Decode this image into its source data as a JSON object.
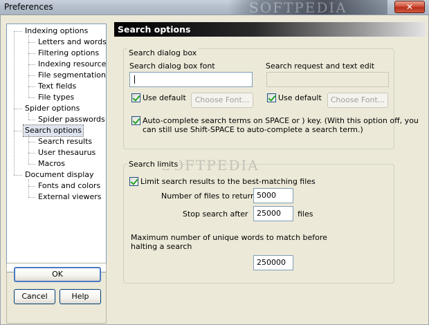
{
  "window": {
    "title": "Preferences",
    "close_glyph": "✕",
    "watermark": "SOFTPEDIA"
  },
  "tree": {
    "items": [
      {
        "label": "Indexing options",
        "level": 0
      },
      {
        "label": "Letters and words",
        "level": 1
      },
      {
        "label": "Filtering options",
        "level": 1
      },
      {
        "label": "Indexing resources",
        "level": 1
      },
      {
        "label": "File segmentation",
        "level": 1
      },
      {
        "label": "Text fields",
        "level": 1
      },
      {
        "label": "File types",
        "level": 1
      },
      {
        "label": "Spider options",
        "level": 0
      },
      {
        "label": "Spider passwords",
        "level": 1
      },
      {
        "label": "Search options",
        "level": 0,
        "selected": true
      },
      {
        "label": "Search results",
        "level": 1
      },
      {
        "label": "User thesaurus",
        "level": 1
      },
      {
        "label": "Macros",
        "level": 1
      },
      {
        "label": "Document display",
        "level": 0
      },
      {
        "label": "Fonts and colors",
        "level": 1
      },
      {
        "label": "External viewers",
        "level": 1
      }
    ]
  },
  "buttons": {
    "ok": "OK",
    "cancel": "Cancel",
    "help": "Help"
  },
  "panel": {
    "title": "Search options",
    "dialog_box": {
      "group_label": "Search dialog box",
      "font_label": "Search dialog box font",
      "font_value": "",
      "request_label": "Search request and text edit",
      "request_value": "",
      "use_default_1": "Use default",
      "use_default_2": "Use default",
      "choose_font_1": "Choose Font...",
      "choose_font_2": "Choose Font...",
      "autocomplete_line1": "Auto-complete search terms on SPACE or ) key.  (With this option off, you",
      "autocomplete_line2": "can still use Shift-SPACE to auto-complete a search term.)"
    },
    "limits": {
      "group_label": "Search limits",
      "limit_checkbox": "Limit search results to the best-matching files",
      "num_files_label": "Number of files to return",
      "num_files_value": "5000",
      "stop_after_label": "Stop search after",
      "stop_after_value": "25000",
      "stop_after_unit": "files",
      "max_words_line1": "Maximum number of unique words to match before",
      "max_words_line2": "halting a search",
      "max_words_value": "250000"
    }
  }
}
